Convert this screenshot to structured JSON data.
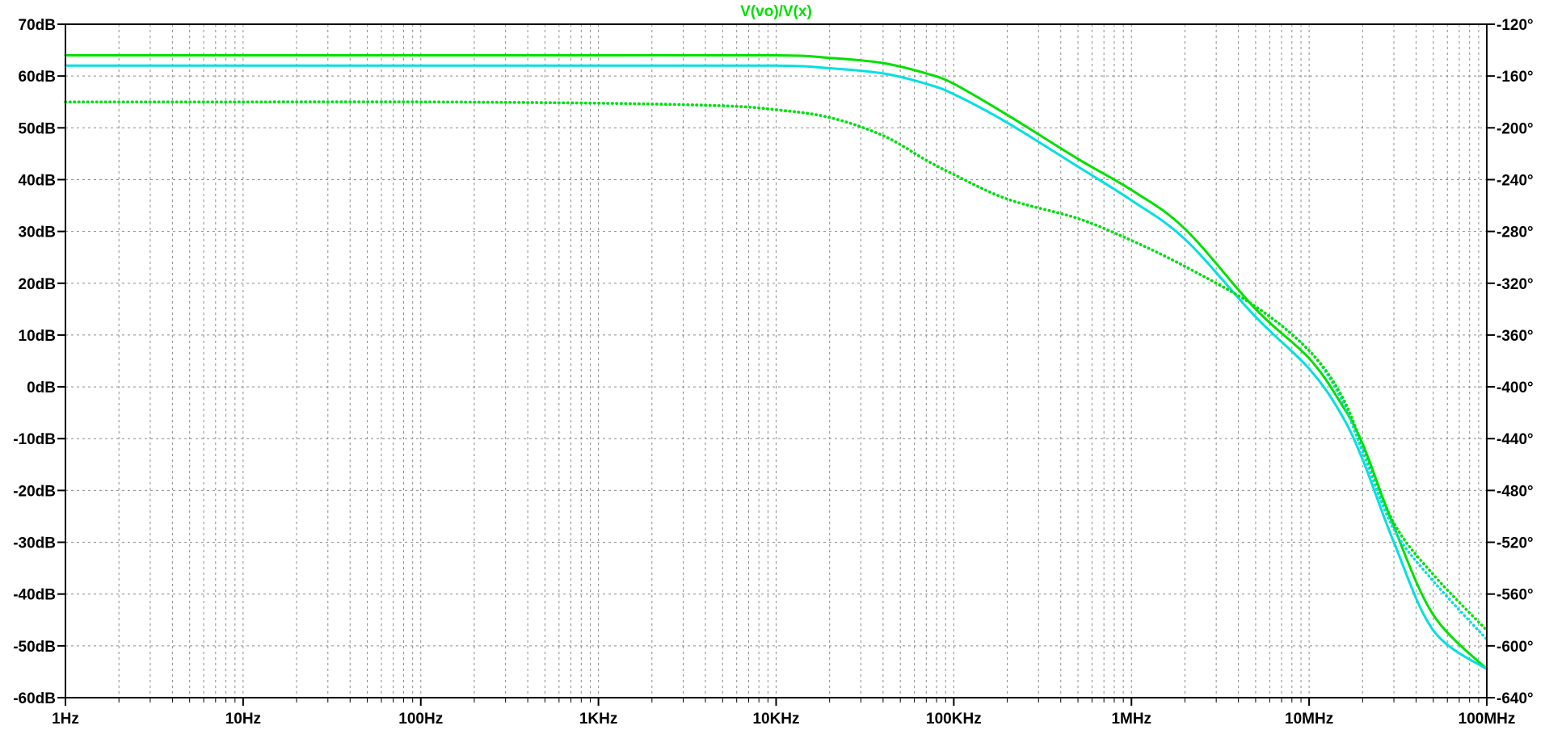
{
  "chart_data": {
    "type": "line",
    "title": "V(vo)/V(x)",
    "title_color": "#00e000",
    "x_scale": "log",
    "x_unit": "Hz",
    "xlim": [
      1,
      100000000
    ],
    "x_ticks": [
      {
        "value": 1,
        "label": "1Hz"
      },
      {
        "value": 10,
        "label": "10Hz"
      },
      {
        "value": 100,
        "label": "100Hz"
      },
      {
        "value": 1000,
        "label": "1KHz"
      },
      {
        "value": 10000,
        "label": "10KHz"
      },
      {
        "value": 100000,
        "label": "100KHz"
      },
      {
        "value": 1000000,
        "label": "1MHz"
      },
      {
        "value": 10000000,
        "label": "10MHz"
      },
      {
        "value": 100000000,
        "label": "100MHz"
      }
    ],
    "y_left": {
      "unit": "dB",
      "ylim": [
        -60,
        70
      ],
      "ticks": [
        {
          "value": 70,
          "label": "70dB"
        },
        {
          "value": 60,
          "label": "60dB"
        },
        {
          "value": 50,
          "label": "50dB"
        },
        {
          "value": 40,
          "label": "40dB"
        },
        {
          "value": 30,
          "label": "30dB"
        },
        {
          "value": 20,
          "label": "20dB"
        },
        {
          "value": 10,
          "label": "10dB"
        },
        {
          "value": 0,
          "label": "0dB"
        },
        {
          "value": -10,
          "label": "-10dB"
        },
        {
          "value": -20,
          "label": "-20dB"
        },
        {
          "value": -30,
          "label": "-30dB"
        },
        {
          "value": -40,
          "label": "-40dB"
        },
        {
          "value": -50,
          "label": "-50dB"
        },
        {
          "value": -60,
          "label": "-60dB"
        }
      ]
    },
    "y_right": {
      "unit": "°",
      "ylim": [
        -640,
        -120
      ],
      "ticks": [
        {
          "value": -120,
          "label": "-120°"
        },
        {
          "value": -160,
          "label": "-160°"
        },
        {
          "value": -200,
          "label": "-200°"
        },
        {
          "value": -240,
          "label": "-240°"
        },
        {
          "value": -280,
          "label": "-280°"
        },
        {
          "value": -320,
          "label": "-320°"
        },
        {
          "value": -360,
          "label": "-360°"
        },
        {
          "value": -400,
          "label": "-400°"
        },
        {
          "value": -440,
          "label": "-440°"
        },
        {
          "value": -480,
          "label": "-480°"
        },
        {
          "value": -520,
          "label": "-520°"
        },
        {
          "value": -560,
          "label": "-560°"
        },
        {
          "value": -600,
          "label": "-600°"
        },
        {
          "value": -640,
          "label": "-640°"
        }
      ]
    },
    "grid": true,
    "grid_style": "dotted",
    "series": [
      {
        "color": "#00e000",
        "axis": "left",
        "style": "solid",
        "x": [
          1,
          100,
          1000,
          10000,
          20000,
          40000,
          70000,
          100000,
          200000,
          500000,
          1000000,
          2000000,
          5000000,
          10000000,
          15000000,
          20000000,
          30000000,
          50000000,
          100000000
        ],
        "y": [
          64,
          64,
          64,
          64,
          63.5,
          62.5,
          60.5,
          58.5,
          52.5,
          44,
          38,
          30.5,
          15,
          5.5,
          -3,
          -11,
          -27,
          -44,
          -54.5
        ]
      },
      {
        "color": "#00e0e0",
        "axis": "left",
        "style": "solid",
        "x": [
          1,
          100,
          1000,
          10000,
          20000,
          40000,
          70000,
          100000,
          200000,
          500000,
          1000000,
          2000000,
          5000000,
          10000000,
          15000000,
          20000000,
          30000000,
          50000000,
          100000000
        ],
        "y": [
          62,
          62,
          62,
          62,
          61.5,
          60.5,
          58.5,
          56.5,
          51,
          42.5,
          36,
          28.5,
          13.5,
          3.5,
          -5,
          -14,
          -30,
          -47,
          -54.5
        ]
      },
      {
        "color": "#00e0e0",
        "axis": "right",
        "style": "dotted",
        "x": [
          1,
          10,
          100,
          1000,
          5000,
          10000,
          20000,
          40000,
          70000,
          100000,
          200000,
          500000,
          1000000,
          2000000,
          5000000,
          10000000,
          15000000,
          20000000,
          30000000,
          50000000,
          100000000
        ],
        "y": [
          -180,
          -180,
          -180,
          -181,
          -183,
          -186,
          -192,
          -206,
          -225,
          -236,
          -255,
          -270,
          -287,
          -307,
          -338,
          -372,
          -408,
          -450,
          -510,
          -550,
          -595
        ]
      },
      {
        "color": "#00e000",
        "axis": "right",
        "style": "dotted",
        "x": [
          1,
          10,
          100,
          1000,
          5000,
          10000,
          20000,
          40000,
          70000,
          100000,
          200000,
          500000,
          1000000,
          2000000,
          5000000,
          10000000,
          15000000,
          20000000,
          30000000,
          50000000,
          100000000
        ],
        "y": [
          -180,
          -180,
          -180,
          -181,
          -183,
          -186,
          -192,
          -206,
          -225,
          -236,
          -255,
          -270,
          -287,
          -307,
          -338,
          -372,
          -405,
          -445,
          -505,
          -545,
          -588
        ]
      }
    ]
  }
}
